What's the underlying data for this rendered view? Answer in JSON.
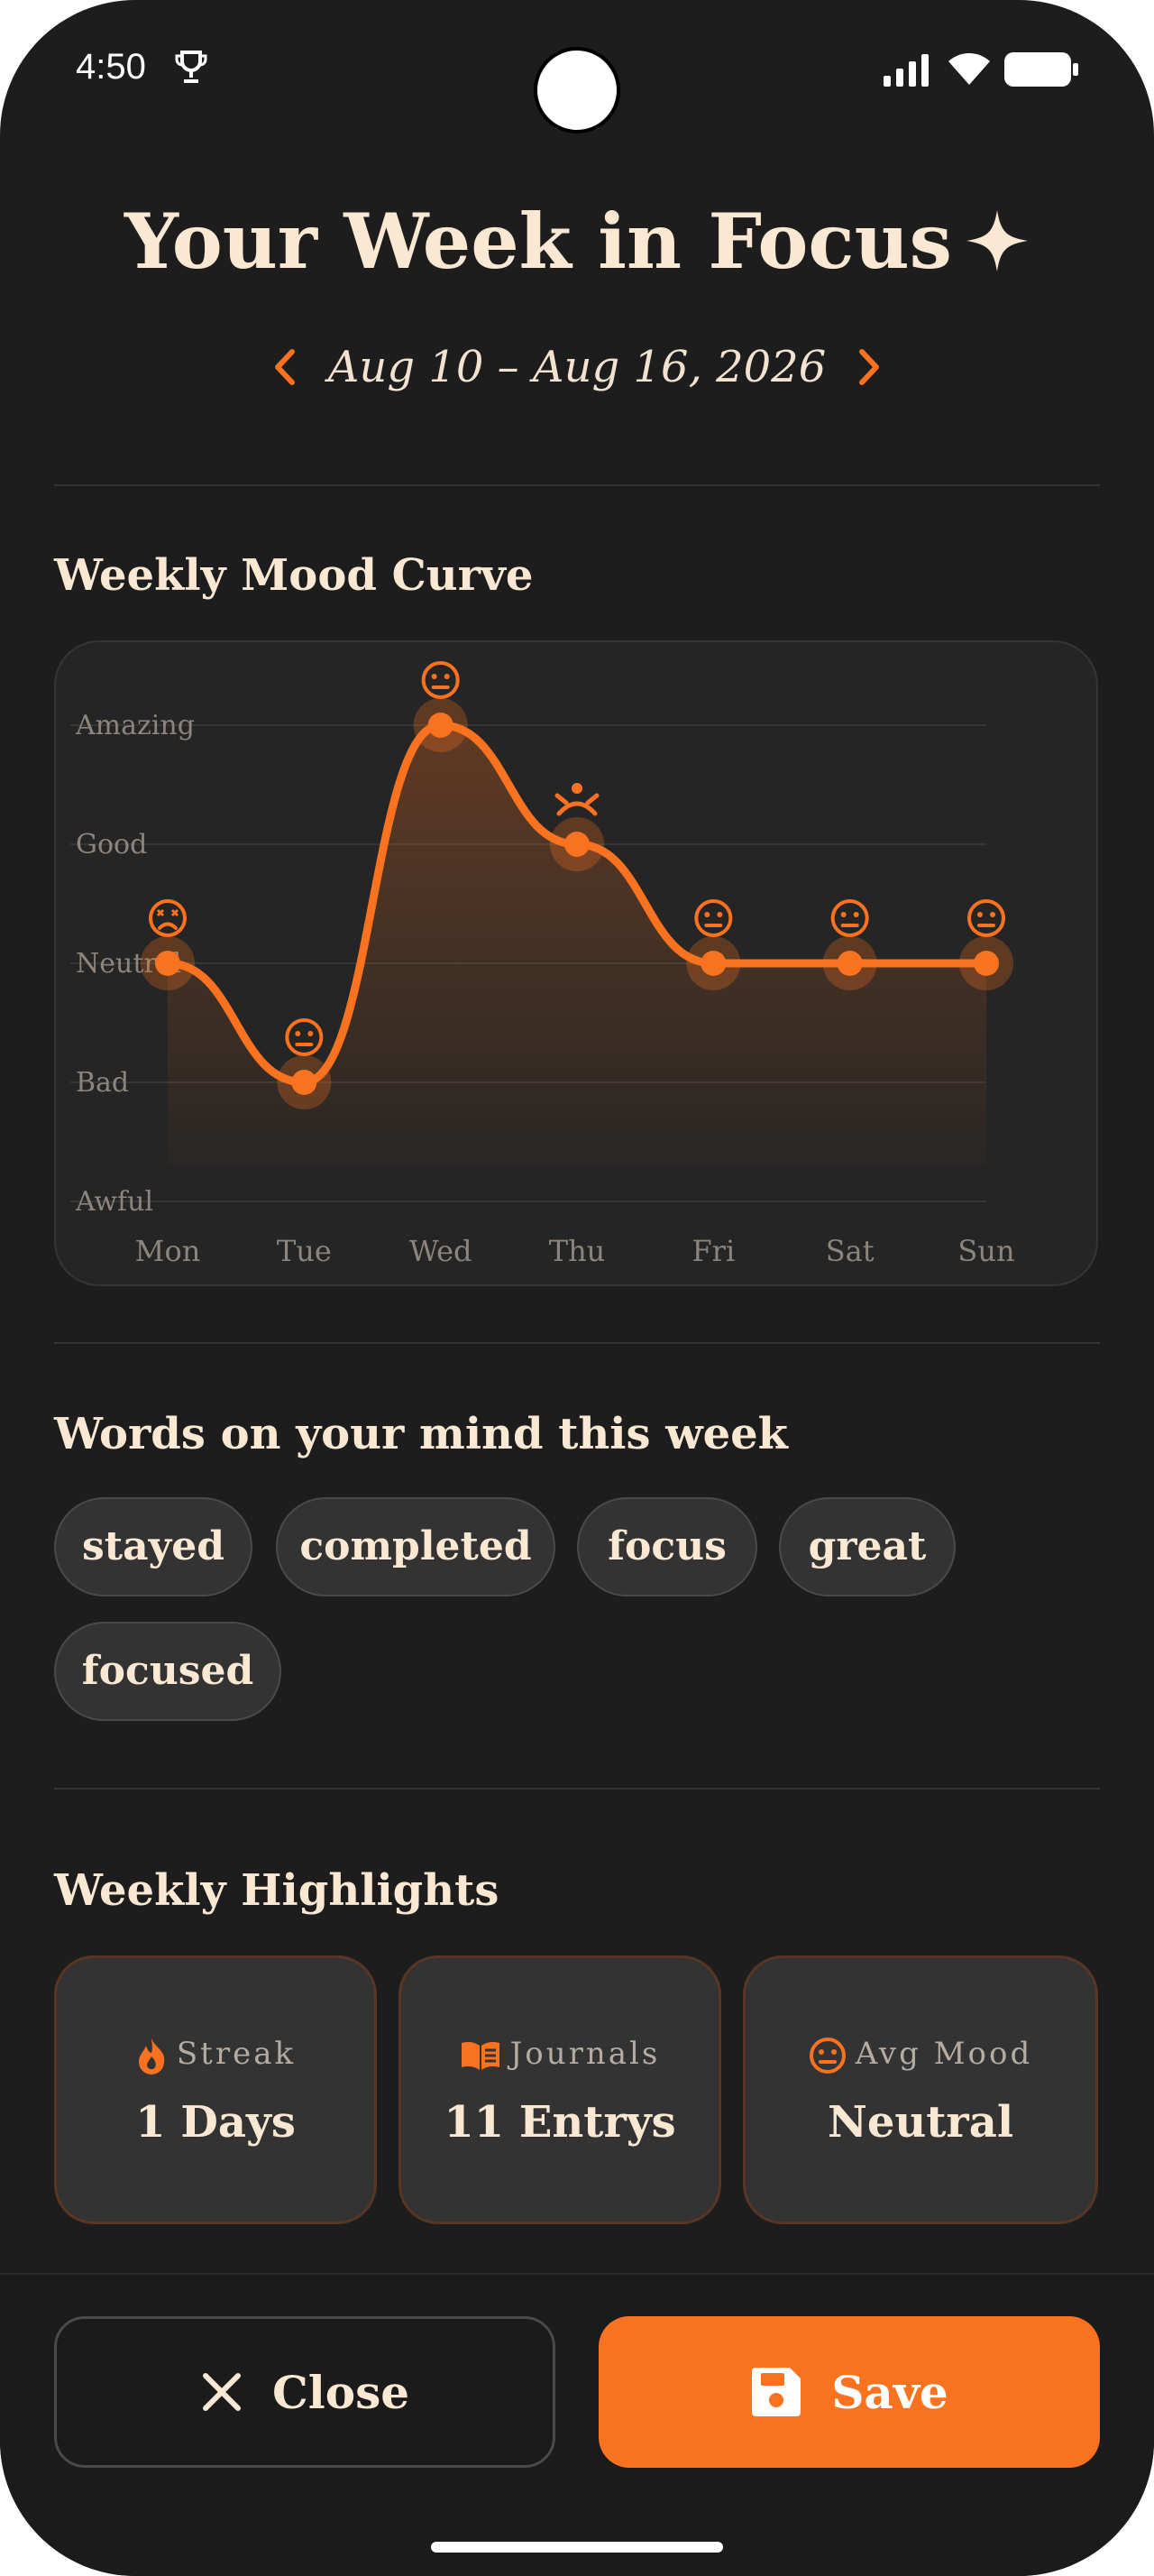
{
  "status_bar": {
    "time": "4:50"
  },
  "header": {
    "title": "Your Week in Focus",
    "date_range": "Aug 10 – Aug 16, 2026"
  },
  "mood_section": {
    "title": "Weekly Mood Curve"
  },
  "chart_data": {
    "type": "line",
    "categories": [
      "Mon",
      "Tue",
      "Wed",
      "Thu",
      "Fri",
      "Sat",
      "Sun"
    ],
    "y_levels": [
      "Awful",
      "Bad",
      "Neutral",
      "Good",
      "Amazing"
    ],
    "values": [
      3,
      2,
      5,
      4,
      3,
      3,
      3
    ],
    "point_icons": [
      "stressed-face-icon",
      "neutral-face-icon",
      "neutral-face-icon",
      "meditation-icon",
      "neutral-face-icon",
      "neutral-face-icon",
      "neutral-face-icon"
    ],
    "ylim": [
      1,
      5
    ],
    "grid": true,
    "smooth": true,
    "area_fill": true,
    "colors": {
      "line": "#f97220",
      "grid": "#353535",
      "label": "#8d857c"
    }
  },
  "words_section": {
    "title": "Words on your mind this week",
    "chips": [
      "stayed",
      "completed",
      "focus",
      "great",
      "focused"
    ]
  },
  "highlights": {
    "title": "Weekly Highlights",
    "cards": [
      {
        "icon": "flame-icon",
        "label": "Streak",
        "value": "1 Days"
      },
      {
        "icon": "book-icon",
        "label": "Journals",
        "value": "11 Entrys"
      },
      {
        "icon": "neutral-face-icon",
        "label": "Avg Mood",
        "value": "Neutral"
      }
    ]
  },
  "actions": {
    "close_label": "Close",
    "save_label": "Save"
  },
  "colors": {
    "accent": "#f97220",
    "background": "#1d1d1d",
    "text": "#fbe8d3"
  }
}
